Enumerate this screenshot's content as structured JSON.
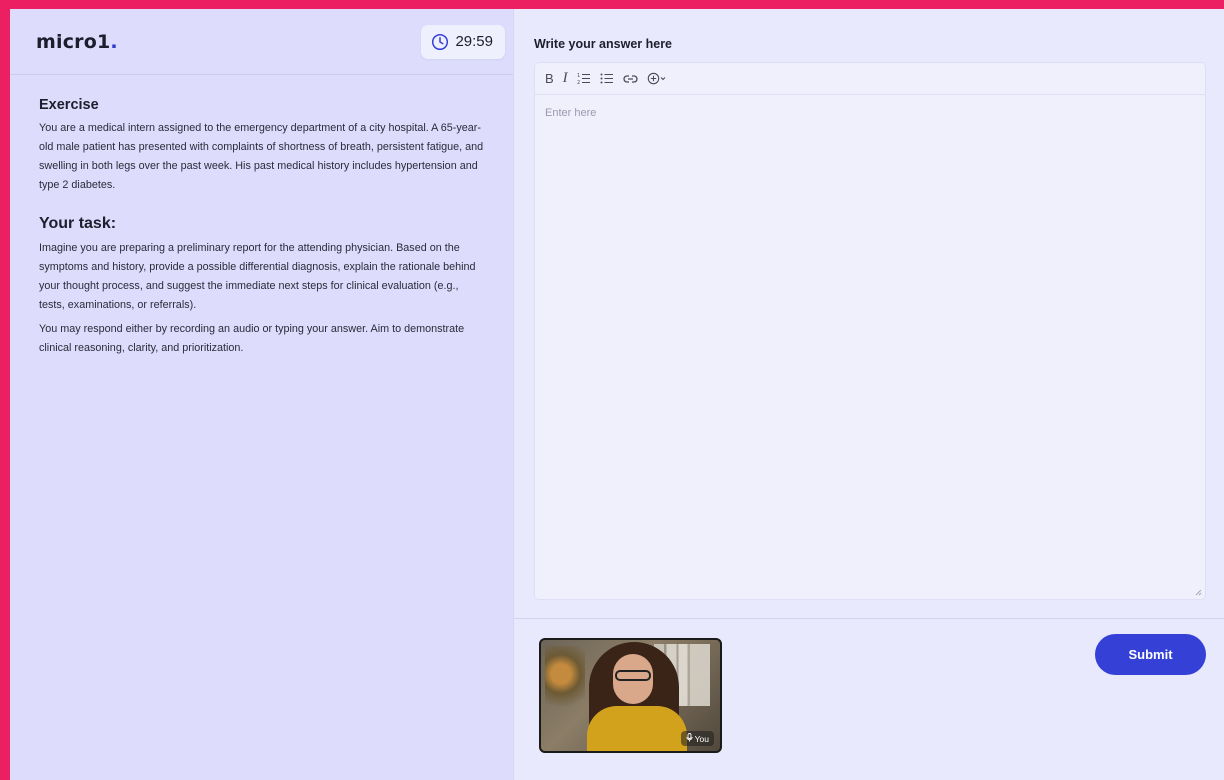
{
  "brand": {
    "name": "micro1",
    "dot": "."
  },
  "timer": {
    "value": "29:59",
    "icon": "clock-icon"
  },
  "exercise": {
    "heading": "Exercise",
    "text": "You are a medical intern assigned to the emergency department of a city hospital. A 65-year-old male patient has presented with complaints of shortness of breath, persistent fatigue, and swelling in both legs over the past week. His past medical history includes hypertension and type 2 diabetes."
  },
  "task": {
    "heading": "Your task:",
    "paragraphs": [
      "Imagine you are preparing a preliminary report for the attending physician. Based on the symptoms and history, provide a possible differential diagnosis, explain the rationale behind your thought process, and suggest the immediate next steps for clinical evaluation (e.g., tests, examinations, or referrals).",
      "You may respond either by recording an audio or typing your answer. Aim to demonstrate clinical reasoning, clarity, and prioritization."
    ]
  },
  "answer": {
    "title": "Write your answer here",
    "placeholder": "Enter here",
    "toolbar": {
      "bold": "B",
      "italic": "I",
      "icons": [
        "bold-icon",
        "italic-icon",
        "numbered-list-icon",
        "bullet-list-icon",
        "link-icon",
        "insert-icon"
      ]
    }
  },
  "video": {
    "label": "You",
    "icon": "microphone-icon"
  },
  "submit": {
    "label": "Submit"
  },
  "colors": {
    "accent": "#3440d6",
    "frame": "#ec1f63",
    "panel": "#dddcfd",
    "logo_dot": "#2f39ce"
  }
}
